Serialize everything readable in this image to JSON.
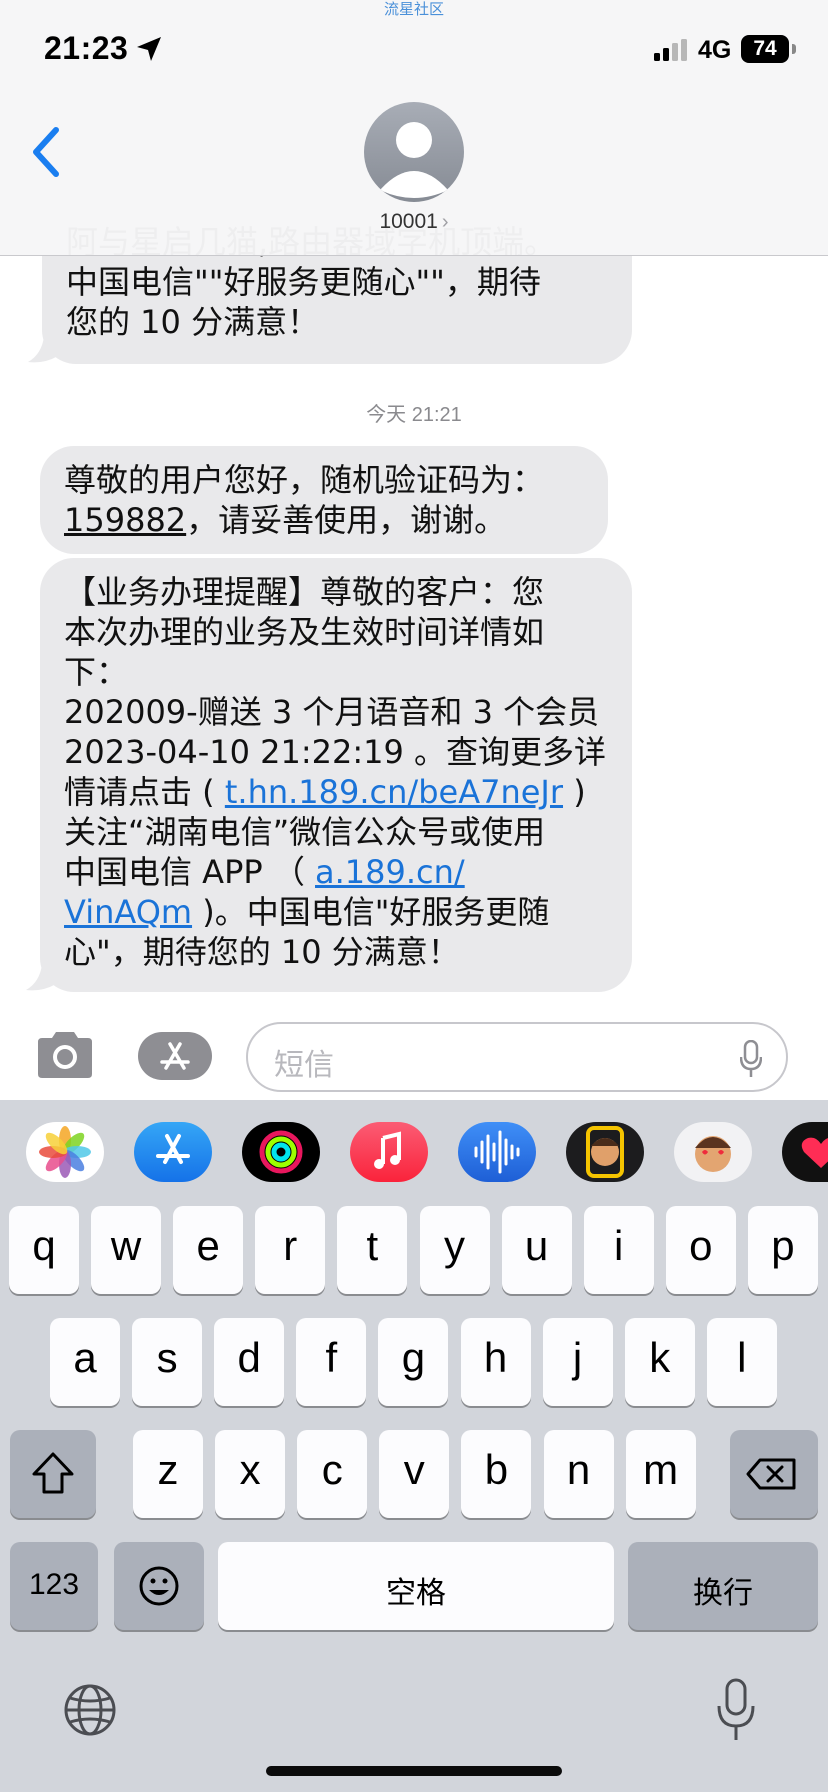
{
  "watermark": "流星社区",
  "status_bar": {
    "time": "21:23",
    "network": "4G",
    "battery": "74",
    "icons": [
      "location-arrow-icon",
      "signal-icon",
      "battery-icon"
    ]
  },
  "header": {
    "back_icon": "chevron-left-icon",
    "contact_name": "10001",
    "contact_chevron": "›"
  },
  "messages": [
    {
      "id": "msg-previous",
      "lines": [
        "阿与星启几猫,路由器域字机顶端。",
        "中国电信\"\"好服务更随心\"\"，期待",
        "您的 10 分满意！"
      ]
    },
    {
      "id": "msg-verification",
      "line1": "尊敬的用户您好，随机验证码为：",
      "code": "159882",
      "line2_rest": "，请妥善使用，谢谢。"
    },
    {
      "id": "msg-business",
      "l1": "【业务办理提醒】尊敬的客户：您",
      "l2": "本次办理的业务及生效时间详情如",
      "l3": "下：",
      "l4": "202009-赠送 3 个月语音和 3 个会员",
      "l5": "2023-04-10 21:22:19 。查询更多详",
      "l6_pre": "情请点击 ( ",
      "l6_link": "t.hn.189.cn/beA7neJr",
      "l6_post": " )",
      "l7": "关注“湖南电信”微信公众号或使用",
      "l8_pre": "中国电信 APP （ ",
      "l8_link": "a.189.cn/",
      "l9_link": "VinAQm",
      "l9_post": " )。中国电信\"好服务更随",
      "l10": "心\"，期待您的 10 分满意！"
    }
  ],
  "date_separator": "今天 21:21",
  "input_bar": {
    "placeholder": "短信",
    "icons": [
      "camera-icon",
      "app-store-icon",
      "microphone-icon"
    ]
  },
  "app_strip": [
    "photos-app-icon",
    "app-store-app-icon",
    "activity-app-icon",
    "music-app-icon",
    "audio-app-icon",
    "memoji-app-icon",
    "memoji-stickers-icon",
    "digital-touch-icon"
  ],
  "keyboard": {
    "row1": [
      "q",
      "w",
      "e",
      "r",
      "t",
      "y",
      "u",
      "i",
      "o",
      "p"
    ],
    "row2": [
      "a",
      "s",
      "d",
      "f",
      "g",
      "h",
      "j",
      "k",
      "l"
    ],
    "row3": [
      "z",
      "x",
      "c",
      "v",
      "b",
      "n",
      "m"
    ],
    "numbers_key": "123",
    "space_key": "空格",
    "return_key": "换行",
    "special_icons": [
      "shift-icon",
      "delete-icon",
      "emoji-icon",
      "globe-icon",
      "dictation-mic-icon"
    ]
  }
}
